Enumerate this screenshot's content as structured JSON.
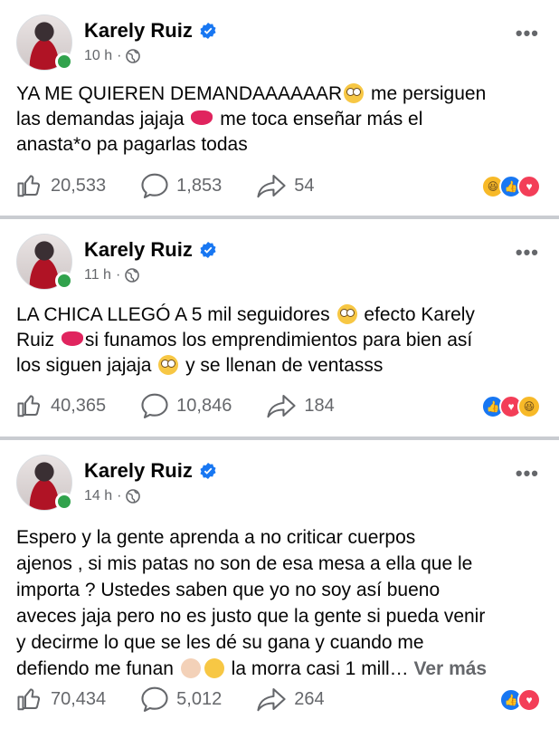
{
  "posts": [
    {
      "author": "Karely Ruiz",
      "time": "10 h",
      "line1": "YA ME QUIEREN DEMANDAAAAAAR",
      "line1b": " me persiguen",
      "line2": "las demandas jajaja ",
      "line2b": " me toca enseñar más el",
      "line3": "anasta*o pa pagarlas todas",
      "likes": "20,533",
      "comments": "1,853",
      "shares": "54",
      "reactions": [
        "haha",
        "like",
        "love"
      ]
    },
    {
      "author": "Karely Ruiz",
      "time": "11 h",
      "line1": "LA CHICA LLEGÓ A 5 mil seguidores ",
      "line1b": " efecto Karely",
      "line2": "Ruiz ",
      "line2b": "si funamos los emprendimientos para bien así",
      "line3": "los siguen jajaja ",
      "line3b": " y se llenan de ventasss",
      "likes": "40,365",
      "comments": "10,846",
      "shares": "184",
      "reactions": [
        "like",
        "love",
        "haha"
      ]
    },
    {
      "author": "Karely Ruiz",
      "time": "14 h",
      "line1": "Espero y la gente aprenda a no criticar cuerpos",
      "line2": "ajenos , si mis patas no son de esa mesa a ella que le",
      "line3": "importa ? Ustedes saben que yo no soy así bueno",
      "line4": "aveces jaja pero no es justo que la gente si pueda venir",
      "line5": "y decirme lo que se les dé su gana y cuando me",
      "line6": "defiendo me funan ",
      "line6b": " la morra casi 1 mill…",
      "see_more": "Ver más",
      "likes": "70,434",
      "comments": "5,012",
      "shares": "264",
      "reactions": [
        "like",
        "love"
      ]
    }
  ],
  "ui": {
    "dot": "·",
    "more": "•••",
    "accent": "#1877f2",
    "online": "#31a24c"
  }
}
